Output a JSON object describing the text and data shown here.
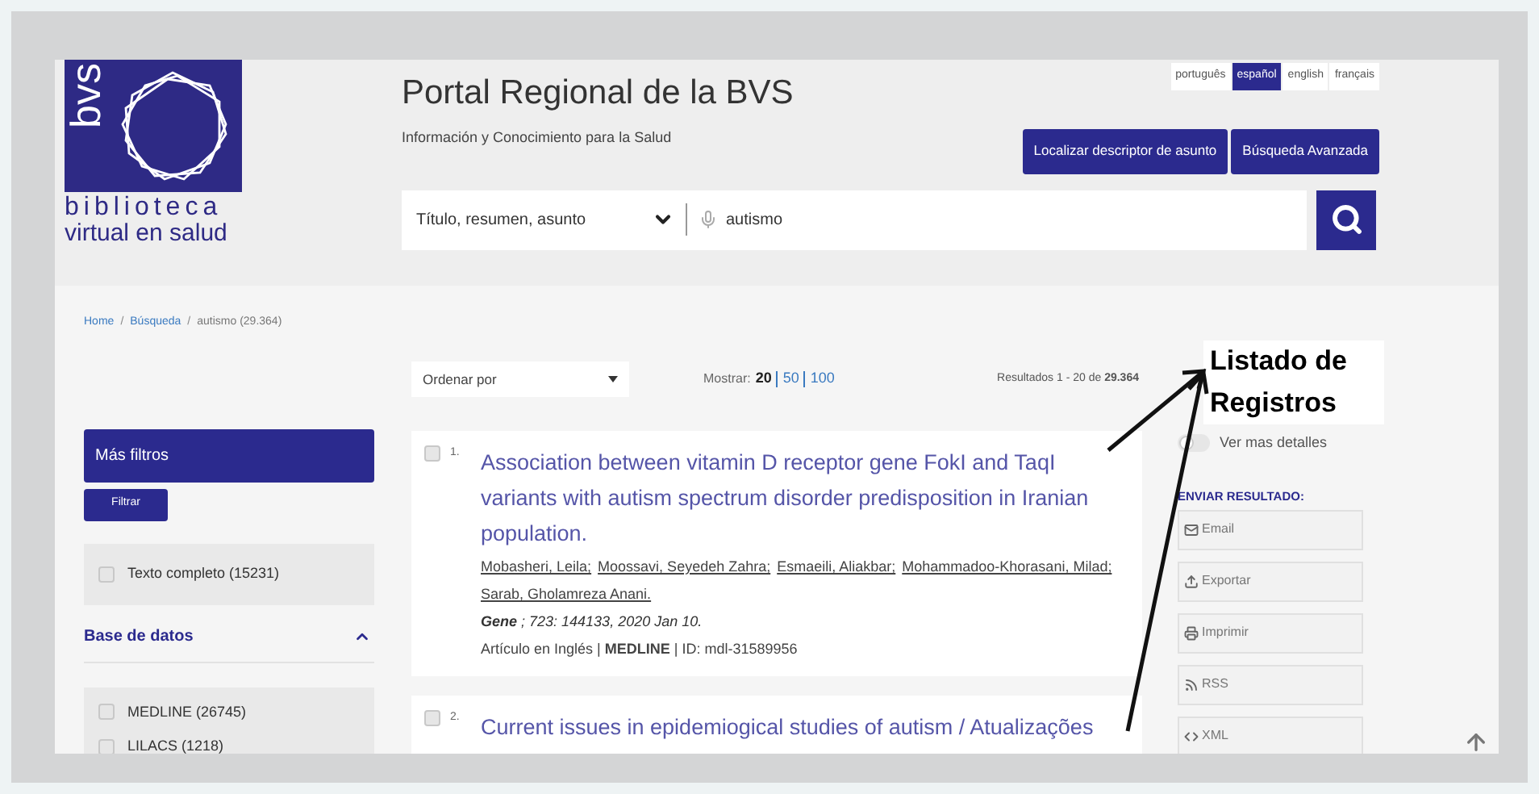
{
  "logo": {
    "mark": "bvs",
    "line_1": "biblioteca",
    "line_2": "virtual en salud"
  },
  "header": {
    "title": "Portal Regional de la BVS",
    "subtitle": "Información y Conocimiento para la Salud",
    "languages": [
      {
        "label": "português",
        "selected": false
      },
      {
        "label": "español",
        "selected": true
      },
      {
        "label": "english",
        "selected": false
      },
      {
        "label": "français",
        "selected": false
      }
    ],
    "buttons": [
      "Localizar descriptor de asunto",
      "Búsqueda Avanzada"
    ],
    "search": {
      "field": "Título, resumen, asunto",
      "value": "autismo"
    }
  },
  "breadcrumb_separator": "/",
  "breadcrumb": [
    {
      "label": "Home",
      "kind": "link"
    },
    {
      "label": "Búsqueda",
      "kind": "link"
    },
    {
      "label": "autismo (29.364)",
      "kind": "current"
    }
  ],
  "filters": {
    "title": "Más filtros",
    "apply": "Filtrar",
    "fulltext": {
      "label": "Texto completo (15231)",
      "checked": false
    },
    "section": {
      "title": "Base de datos",
      "expanded": true,
      "options": [
        {
          "label": "MEDLINE (26745)",
          "checked": false
        },
        {
          "label": "LILACS (1218)",
          "checked": false
        }
      ]
    }
  },
  "results_bar": {
    "sort": "Ordenar por",
    "show_label": "Mostrar:",
    "page_sizes": [
      {
        "label": "20",
        "selected": true
      },
      {
        "label": "50",
        "selected": false
      },
      {
        "label": "100",
        "selected": false
      }
    ],
    "summary": "Resultados 1 - 20 de **29.364**"
  },
  "results": [
    {
      "number": "1.",
      "checked": false,
      "title": "Association between vitamin D receptor gene FokI and TaqI variants with autism spectrum disorder predisposition in Iranian population.",
      "authors": [
        "Mobasheri, Leila;",
        "Moossavi, Seyedeh Zahra;",
        "Esmaeili, Aliakbar;",
        "Mohammadoo-Khorasani, Milad;",
        "Sarab, Gholamreza Anani."
      ],
      "journal": "**Gene** ; 723: 144133, 2020 Jan 10.",
      "meta": "Artículo en Inglés | **MEDLINE** | ID: mdl-31589956"
    },
    {
      "number": "2.",
      "checked": false,
      "title": "Current issues in epidemiogical studies of autism / Atualizações"
    }
  ],
  "details_toggle": {
    "label": "Ver mas detalles",
    "on": false
  },
  "send": {
    "title": "ENVIAR RESULTADO:",
    "buttons": [
      {
        "label": "Email",
        "kind": "email"
      },
      {
        "label": "Exportar",
        "kind": "export"
      },
      {
        "label": "Imprimir",
        "kind": "print"
      },
      {
        "label": "RSS",
        "kind": "rss"
      },
      {
        "label": "XML",
        "kind": "xml"
      }
    ]
  },
  "annotation": {
    "text": "Listado de Registros"
  }
}
